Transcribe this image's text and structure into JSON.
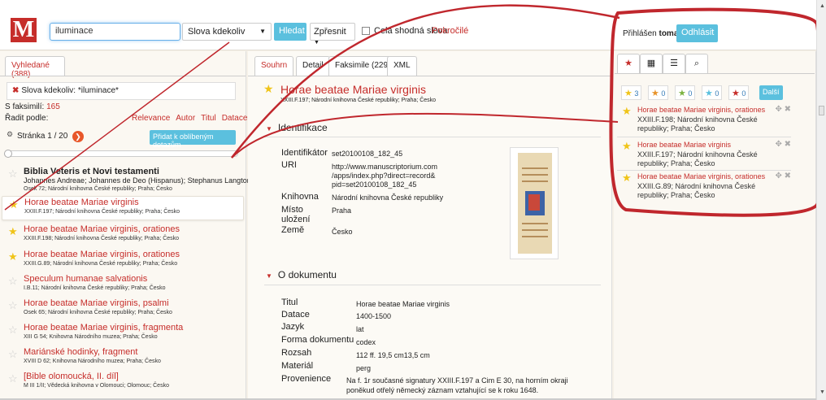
{
  "header": {
    "logo": "M",
    "search_value": "iluminace",
    "scope_select": "Slova kdekoliv",
    "search_button": "Hledat",
    "refine_button": "Zpřesnit",
    "exact_label": "Celá shodná slova",
    "advanced_link": "Pokročilé",
    "user_prefix": "Přihlášen",
    "user_name": "tomas",
    "logout_button": "Odhlásit"
  },
  "left": {
    "tab": "Vyhledané (388)",
    "filter_text": "Slova kdekoliv: *iluminace*",
    "facsimile_label": "S faksimilí:",
    "facsimile_count": "165",
    "sort_label": "Řadit podle:",
    "sort_options": [
      "Relevance",
      "Autor",
      "Titul",
      "Datace"
    ],
    "page_label": "Stránka 1 / 20",
    "fav_query_button": "Přidat k oblíbeným dotazům",
    "items": [
      {
        "title": "Biblia Veteris et Novi testamenti",
        "author": "Johannes Andreae; Johannes de Deo (Hispanus); Stephanus Langton",
        "sub": "Osek 72; Národní knihovna České republiky; Praha; Česko",
        "starred": false
      },
      {
        "title": "Horae beatae Mariae virginis",
        "sub": "XXIII.F.197; Národní knihovna České republiky; Praha; Česko",
        "starred": true
      },
      {
        "title": "Horae beatae Mariae virginis, orationes",
        "sub": "XXIII.F.198; Národní knihovna České republiky; Praha; Česko",
        "starred": true
      },
      {
        "title": "Horae beatae Mariae virginis, orationes",
        "sub": "XXIII.G.89; Národní knihovna České republiky; Praha; Česko",
        "starred": true
      },
      {
        "title": "Speculum humanae salvationis",
        "sub": "I.B.11; Národní knihovna České republiky; Praha; Česko",
        "starred": false
      },
      {
        "title": "Horae beatae Mariae virginis, psalmi",
        "sub": "Osek 65; Národní knihovna České republiky; Praha; Česko",
        "starred": false
      },
      {
        "title": "Horae beatae Mariae virginis, fragmenta",
        "sub": "XIII G 54; Knihovna Národního muzea; Praha; Česko",
        "starred": false
      },
      {
        "title": "Mariánské hodinky, fragment",
        "sub": "XVIII D 62; Knihovna Národního muzea; Praha; Česko",
        "starred": false
      },
      {
        "title": "[Bible olomoucká, II. díl]",
        "sub": "M III 1/II; Vědecká knihovna v Olomouci; Olomouc; Česko",
        "starred": false
      }
    ]
  },
  "middle": {
    "tabs": [
      "Souhrn",
      "Detail",
      "Faksimile (229)",
      "XML"
    ],
    "title": "Horae beatae Mariae virginis",
    "subtitle": "XXIII.F.197; Národní knihovna České republiky; Praha; Česko",
    "section_ident": "Identifikace",
    "ident": {
      "id_label": "Identifikátor",
      "id_value": "set20100108_182_45",
      "uri_label": "URI",
      "uri_lines": [
        "http://www.manuscriptorium.com",
        "/apps/index.php?direct=record&",
        "pid=set20100108_182_45"
      ],
      "library_label": "Knihovna",
      "library_value": "Národní knihovna České republiky",
      "place_label_1": "Místo",
      "place_label_2": "uložení",
      "place_value": "Praha",
      "country_label": "Země",
      "country_value": "Česko"
    },
    "section_doc": "O dokumentu",
    "doc": {
      "title_label": "Titul",
      "title_value": "Horae beatae Mariae virginis",
      "date_label": "Datace",
      "date_value": "1400-1500",
      "lang_label": "Jazyk",
      "lang_value": "lat",
      "form_label": "Forma dokumentu",
      "form_value": "codex",
      "extent_label": "Rozsah",
      "extent_value": "112 ff. 19,5 cm13,5 cm",
      "material_label": "Materiál",
      "material_value": "perg",
      "prov_label": "Provenience",
      "prov_line1": "Na f. 1r současné signatury XXIII.F.197 a Cim E 30, na horním okraji",
      "prov_line2": "poněkud otřelý německý záznam vztahující se k roku 1648."
    }
  },
  "right": {
    "tab_icons": [
      "star-icon",
      "grid-icon",
      "list-icon",
      "search-icon"
    ],
    "counters": [
      {
        "value": "3",
        "color": "#f0c419"
      },
      {
        "value": "0",
        "color": "#e8932a"
      },
      {
        "value": "0",
        "color": "#7cb342"
      },
      {
        "value": "0",
        "color": "#5bc0de"
      },
      {
        "value": "0",
        "color": "#c62d2a"
      }
    ],
    "more_button": "Další",
    "cards": [
      {
        "title": "Horae beatae Mariae virginis, orationes",
        "desc": "XXIII.F.198; Národní knihovna České republiky; Praha; Česko"
      },
      {
        "title": "Horae beatae Mariae virginis",
        "desc": "XXIII.F.197; Národní knihovna České republiky; Praha; Česko"
      },
      {
        "title": "Horae beatae Mariae virginis, orationes",
        "desc": "XXIII.G.89; Národní knihovna České republiky; Praha; Česko"
      }
    ]
  }
}
